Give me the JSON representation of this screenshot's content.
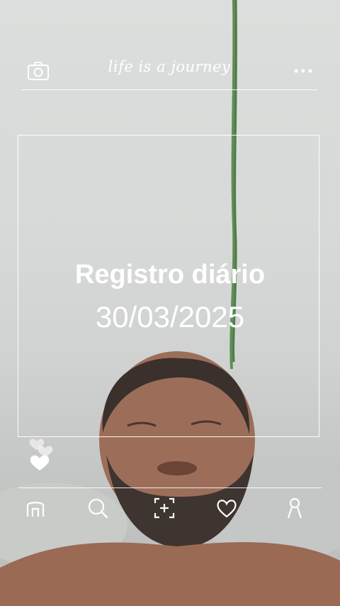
{
  "header": {
    "camera_icon": "camera-icon",
    "brand": "life is a journey",
    "more_icon": "more-dots-icon"
  },
  "main": {
    "title": "Registro diário",
    "date": "30/03/2025"
  },
  "nav": {
    "items": [
      {
        "icon": "home-icon"
      },
      {
        "icon": "search-icon"
      },
      {
        "icon": "add-photo-icon"
      },
      {
        "icon": "heart-icon"
      },
      {
        "icon": "profile-icon"
      }
    ]
  },
  "colors": {
    "overlay_text": "#ffffff",
    "background": "#d7d9d8"
  }
}
